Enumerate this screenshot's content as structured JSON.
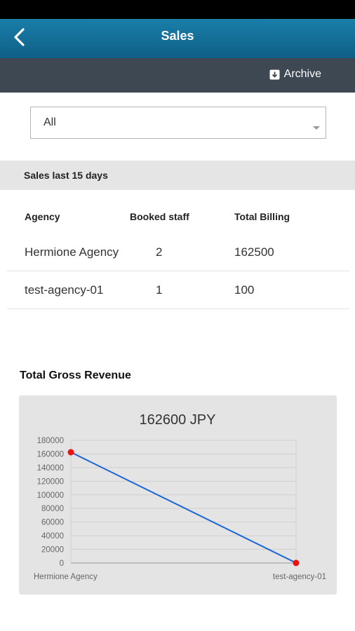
{
  "header": {
    "title": "Sales",
    "back_icon": "chevron-left-icon"
  },
  "toolbar": {
    "archive_label": "Archive",
    "archive_icon": "archive-box-icon"
  },
  "filter": {
    "selected": "All"
  },
  "section": {
    "title": "Sales last 15 days"
  },
  "table": {
    "headers": [
      "Agency",
      "Booked staff",
      "Total Billing"
    ],
    "rows": [
      [
        "Hermione Agency",
        "2",
        "162500"
      ],
      [
        "test-agency-01",
        "1",
        "100"
      ]
    ]
  },
  "revenue": {
    "title": "Total Gross Revenue"
  },
  "chart_data": {
    "type": "line",
    "title": "162600 JPY",
    "categories": [
      "Hermione Agency",
      "test-agency-01"
    ],
    "series": [
      {
        "values": [
          162500,
          100
        ],
        "color": "#1a66d6",
        "point_color": "#ee1111"
      }
    ],
    "ylim": [
      0,
      180000
    ],
    "yticks": [
      "0",
      "20000",
      "40000",
      "60000",
      "80000",
      "100000",
      "120000",
      "140000",
      "160000",
      "180000"
    ],
    "grid": true,
    "xlabel": "",
    "ylabel": ""
  },
  "colors": {
    "app_bar": "#1a7fa9",
    "sub_bar": "#3e4852",
    "line": "#1a66d6",
    "point": "#ee1111"
  }
}
